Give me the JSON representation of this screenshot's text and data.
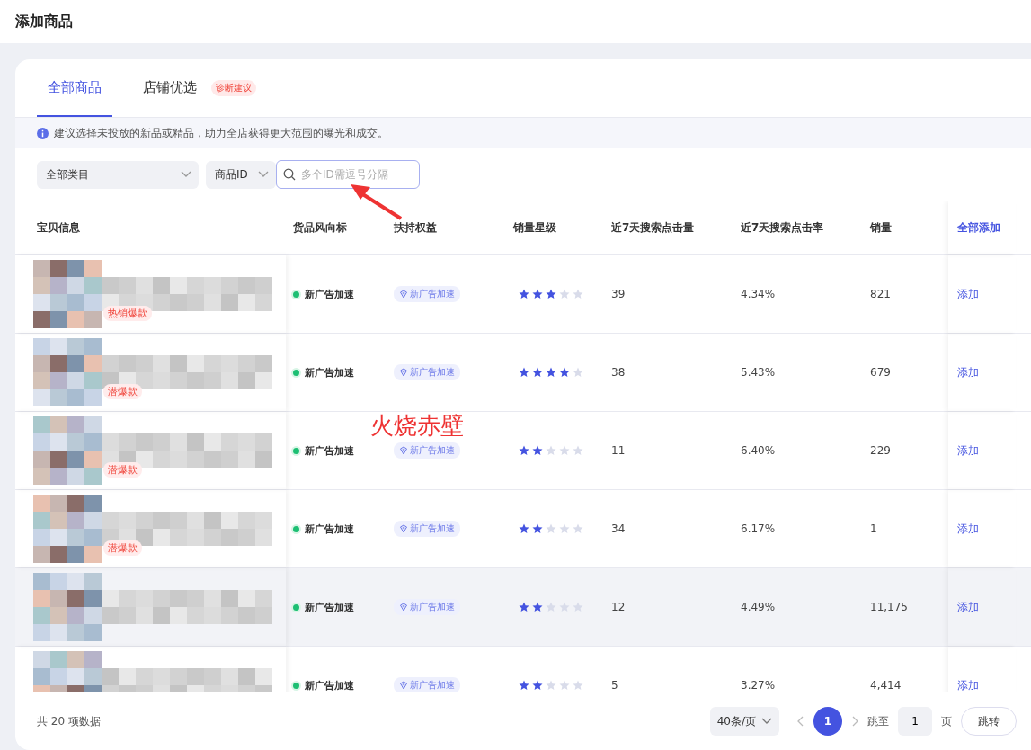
{
  "page_title": "添加商品",
  "tabs": [
    {
      "label": "全部商品",
      "selected": true
    },
    {
      "label": "店铺优选",
      "selected": false,
      "badge": "诊断建议"
    }
  ],
  "notice": "建议选择未投放的新品或精品，助力全店获得更大范围的曝光和成交。",
  "filters": {
    "category": "全部类目",
    "id_type": "商品ID",
    "search_placeholder": "多个ID需逗号分隔"
  },
  "table": {
    "columns": [
      "宝贝信息",
      "货品风向标",
      "扶持权益",
      "销量星级",
      "近7天搜索点击量",
      "近7天搜索点击率",
      "销量"
    ],
    "add_all": "全部添加",
    "rows": [
      {
        "product": {
          "kind": "picture",
          "tag": "热销爆款"
        },
        "indicator": "新广告加速",
        "benefit": "新广告加速",
        "stars": 3,
        "clicks": "39",
        "ctr": "4.34%",
        "sales": "821",
        "action": "添加",
        "hovered": false
      },
      {
        "product": {
          "kind": "picture",
          "tag": "潜爆款"
        },
        "indicator": "新广告加速",
        "benefit": "新广告加速",
        "stars": 4,
        "clicks": "38",
        "ctr": "5.43%",
        "sales": "679",
        "action": "添加",
        "hovered": false
      },
      {
        "product": {
          "kind": "picture",
          "tag": "潜爆款"
        },
        "indicator": "新广告加速",
        "benefit": "新广告加速",
        "stars": 2,
        "clicks": "11",
        "ctr": "6.40%",
        "sales": "229",
        "action": "添加",
        "hovered": false
      },
      {
        "product": {
          "kind": "picture",
          "tag": "潜爆款"
        },
        "indicator": "新广告加速",
        "benefit": "新广告加速",
        "stars": 2,
        "clicks": "34",
        "ctr": "6.17%",
        "sales": "1",
        "action": "添加",
        "hovered": false
      },
      {
        "indicator": "新广告加速",
        "benefit": "新广告加速",
        "stars": 2,
        "clicks": "12",
        "ctr": "4.49%",
        "sales": "11,175",
        "action": "添加",
        "hovered": true
      },
      {
        "indicator": "新广告加速",
        "benefit": "新广告加速",
        "stars": 2,
        "clicks": "5",
        "ctr": "3.27%",
        "sales": "4,414",
        "action": "添加",
        "hovered": false
      }
    ]
  },
  "footer": {
    "total": "共 20 项数据",
    "page_size": "40条/页",
    "pages": [
      {
        "label": "1",
        "selected": true
      }
    ],
    "jump_label": "跳至",
    "jump_value": "1",
    "page_unit": "页",
    "jump_button": "跳转"
  },
  "annotation": {
    "text": "火烧赤壁"
  }
}
